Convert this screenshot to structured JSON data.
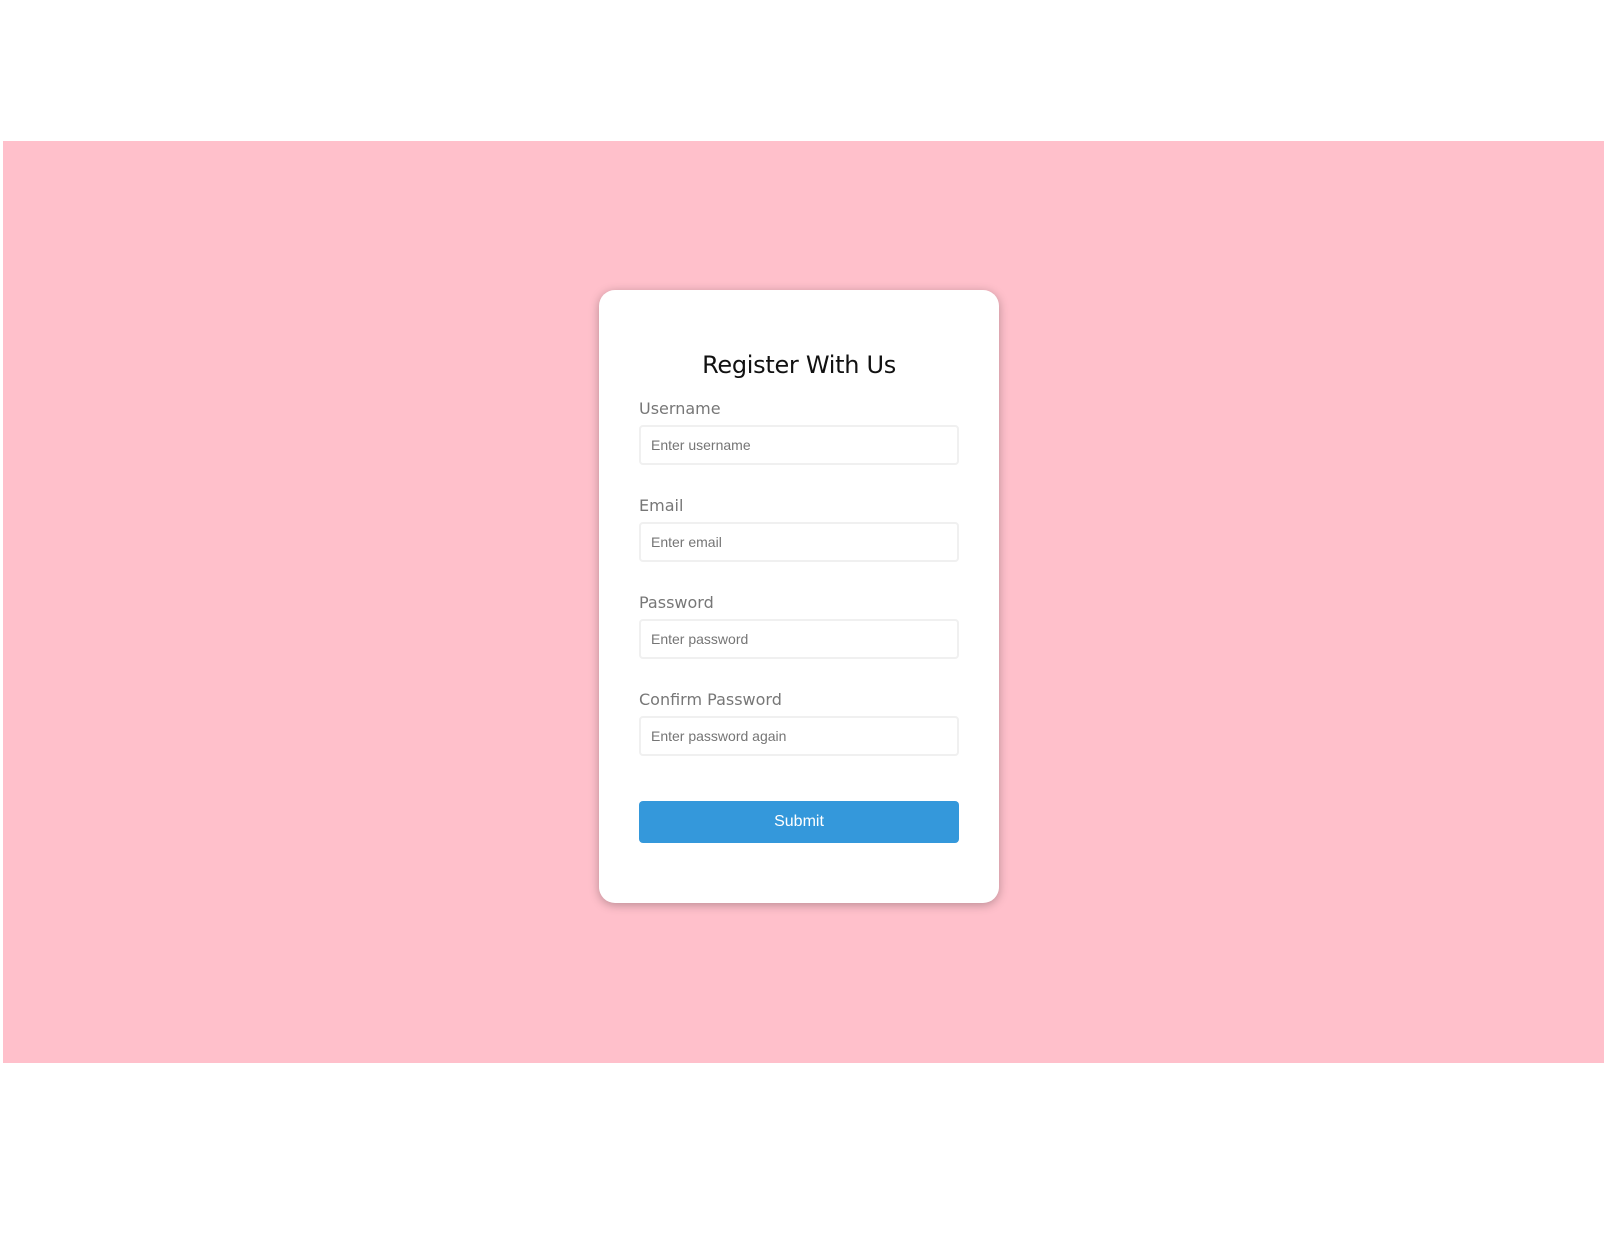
{
  "colors": {
    "page_background": "#ffffff",
    "band_background": "#ffc0cb",
    "card_background": "#ffffff",
    "button_background": "#3498db",
    "button_text": "#ffffff"
  },
  "form": {
    "title": "Register With Us",
    "fields": [
      {
        "label": "Username",
        "placeholder": "Enter username",
        "value": ""
      },
      {
        "label": "Email",
        "placeholder": "Enter email",
        "value": ""
      },
      {
        "label": "Password",
        "placeholder": "Enter password",
        "value": ""
      },
      {
        "label": "Confirm Password",
        "placeholder": "Enter password again",
        "value": ""
      }
    ],
    "submit_label": "Submit"
  }
}
